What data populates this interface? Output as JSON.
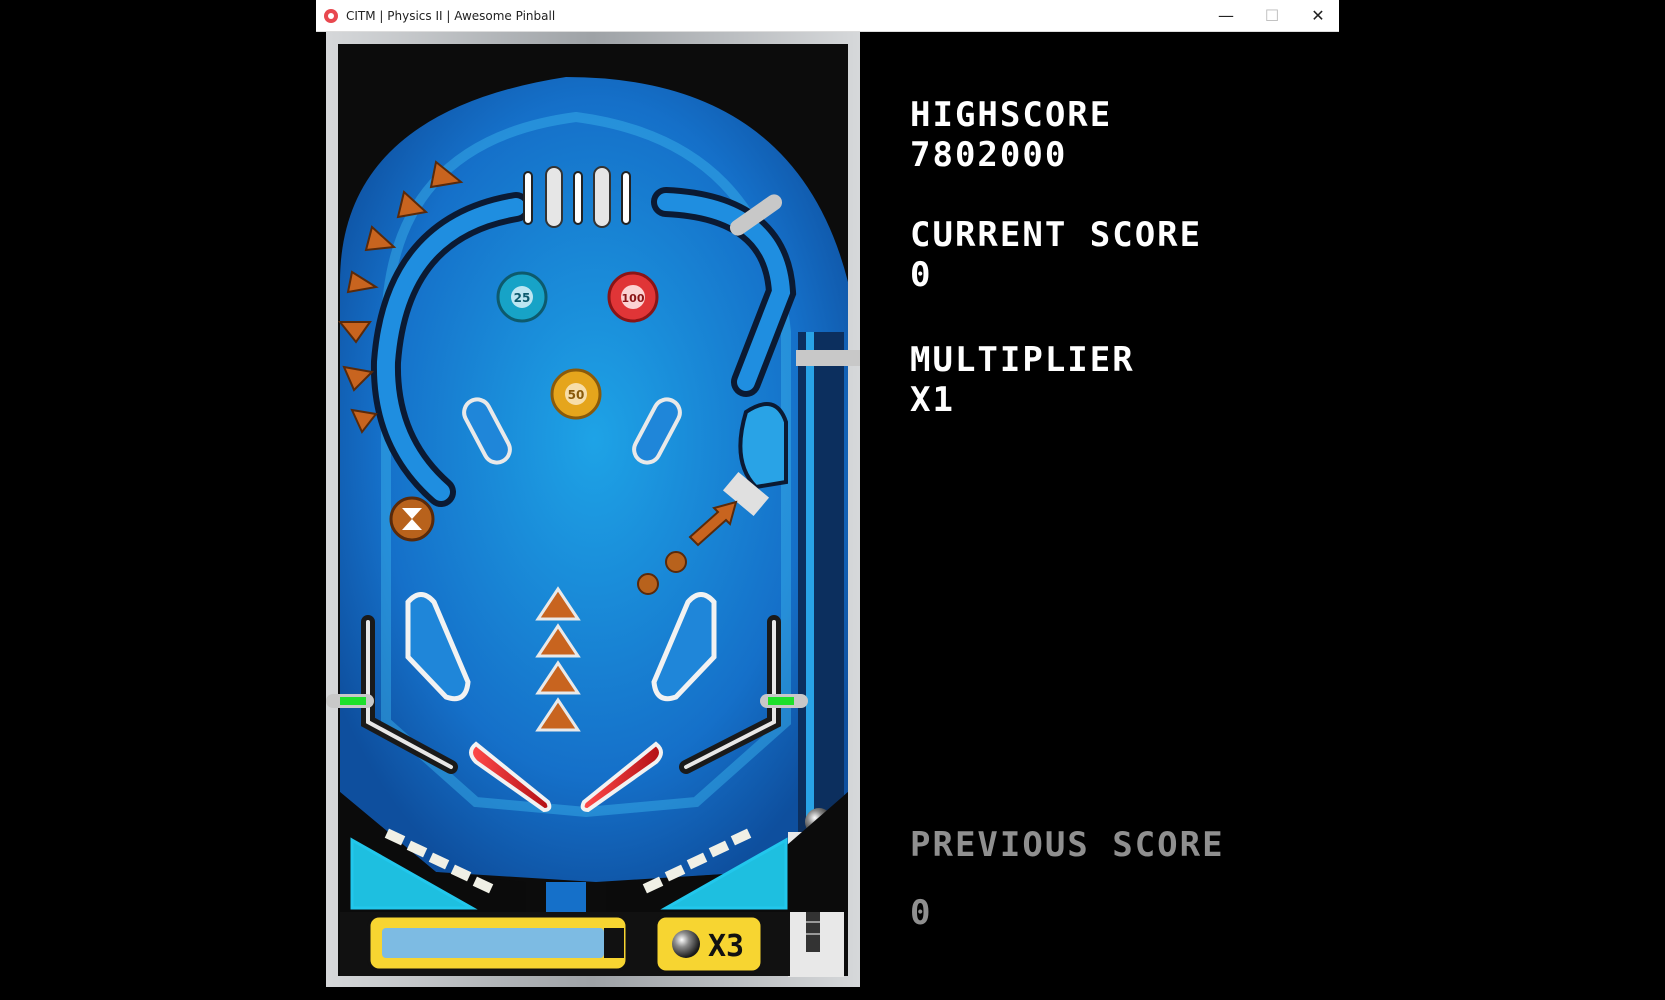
{
  "window": {
    "title": "CITM | Physics II | Awesome Pinball",
    "min_glyph": "—",
    "max_glyph": "☐",
    "close_glyph": "✕"
  },
  "hud": {
    "highscore_label": "HIGHSCORE",
    "highscore_value": "7802000",
    "current_label": "CURRENT SCORE",
    "current_value": "0",
    "multiplier_label": "MULTIPLIER",
    "multiplier_value": "X1",
    "previous_label": "PREVIOUS SCORE",
    "previous_value": "0"
  },
  "board": {
    "bumpers": [
      "25",
      "100",
      "50"
    ],
    "lives_badge": "X3",
    "colors": {
      "table_blue": "#1a7fd6",
      "frame_gray": "#b9bcc0",
      "flipper_red": "#e0262b",
      "arrow_brown": "#b8621c",
      "bumper_yellow": "#e5a51c",
      "bar_yellow": "#f7d531",
      "bar_fill": "#7dbbe3",
      "lane_green": "#1de02b"
    }
  }
}
